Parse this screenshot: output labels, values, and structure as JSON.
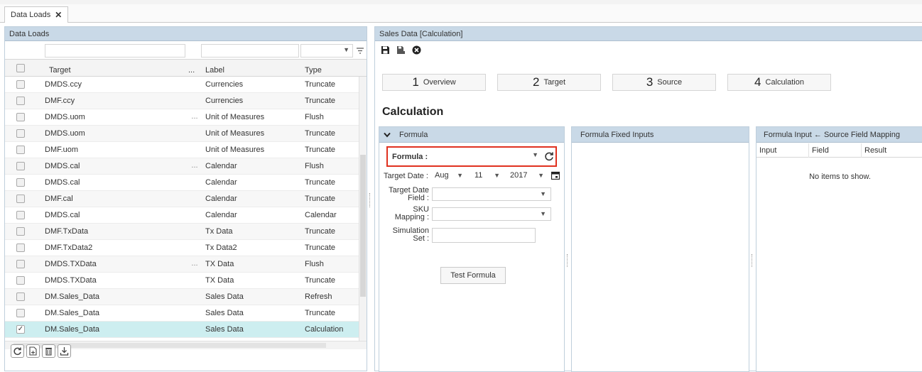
{
  "tab": {
    "label": "Data Loads",
    "close": "✕"
  },
  "left": {
    "title": "Data Loads",
    "columns": {
      "target": "Target",
      "dots": "...",
      "label": "Label",
      "type": "Type"
    },
    "rows": [
      {
        "target": "DMDS.ccy",
        "dots": "",
        "label": "Currencies",
        "type": "Truncate",
        "checked": false
      },
      {
        "target": "DMF.ccy",
        "dots": "",
        "label": "Currencies",
        "type": "Truncate",
        "checked": false
      },
      {
        "target": "DMDS.uom",
        "dots": "...",
        "label": "Unit of Measures",
        "type": "Flush",
        "checked": false
      },
      {
        "target": "DMDS.uom",
        "dots": "",
        "label": "Unit of Measures",
        "type": "Truncate",
        "checked": false
      },
      {
        "target": "DMF.uom",
        "dots": "",
        "label": "Unit of Measures",
        "type": "Truncate",
        "checked": false
      },
      {
        "target": "DMDS.cal",
        "dots": "...",
        "label": "Calendar",
        "type": "Flush",
        "checked": false
      },
      {
        "target": "DMDS.cal",
        "dots": "",
        "label": "Calendar",
        "type": "Truncate",
        "checked": false
      },
      {
        "target": "DMF.cal",
        "dots": "",
        "label": "Calendar",
        "type": "Truncate",
        "checked": false
      },
      {
        "target": "DMDS.cal",
        "dots": "",
        "label": "Calendar",
        "type": "Calendar",
        "checked": false
      },
      {
        "target": "DMF.TxData",
        "dots": "",
        "label": "Tx Data",
        "type": "Truncate",
        "checked": false
      },
      {
        "target": "DMF.TxData2",
        "dots": "",
        "label": "Tx Data2",
        "type": "Truncate",
        "checked": false
      },
      {
        "target": "DMDS.TXData",
        "dots": "...",
        "label": "TX Data",
        "type": "Flush",
        "checked": false
      },
      {
        "target": "DMDS.TXData",
        "dots": "",
        "label": "TX Data",
        "type": "Truncate",
        "checked": false
      },
      {
        "target": "DM.Sales_Data",
        "dots": "",
        "label": "Sales Data",
        "type": "Refresh",
        "checked": false
      },
      {
        "target": "DM.Sales_Data",
        "dots": "",
        "label": "Sales Data",
        "type": "Truncate",
        "checked": false
      },
      {
        "target": "DM.Sales_Data",
        "dots": "",
        "label": "Sales Data",
        "type": "Calculation",
        "checked": true
      }
    ]
  },
  "right": {
    "title": "Sales Data  [Calculation]",
    "steps": [
      {
        "num": "1",
        "label": "Overview"
      },
      {
        "num": "2",
        "label": "Target"
      },
      {
        "num": "3",
        "label": "Source"
      },
      {
        "num": "4",
        "label": "Calculation"
      }
    ],
    "section_title": "Calculation",
    "formula_panel": {
      "title": "Formula",
      "formula_label": "Formula :",
      "target_date_label": "Target Date :",
      "month": "Aug",
      "day": "11",
      "year": "2017",
      "target_date_field_label_1": "Target Date",
      "target_date_field_label_2": "Field :",
      "sku_label_1": "SKU",
      "sku_label_2": "Mapping :",
      "sim_label_1": "Simulation",
      "sim_label_2": "Set :",
      "test_button": "Test Formula"
    },
    "fixed_panel": {
      "title": "Formula Fixed Inputs"
    },
    "mapping_panel": {
      "title": "Formula Input ← Source Field Mapping",
      "columns": [
        "Input",
        "Field",
        "Result"
      ],
      "empty": "No items to show."
    }
  },
  "colors": {
    "header": "#c9d9e7",
    "selected_row": "#cdeef0",
    "highlight": "#e0311f"
  }
}
